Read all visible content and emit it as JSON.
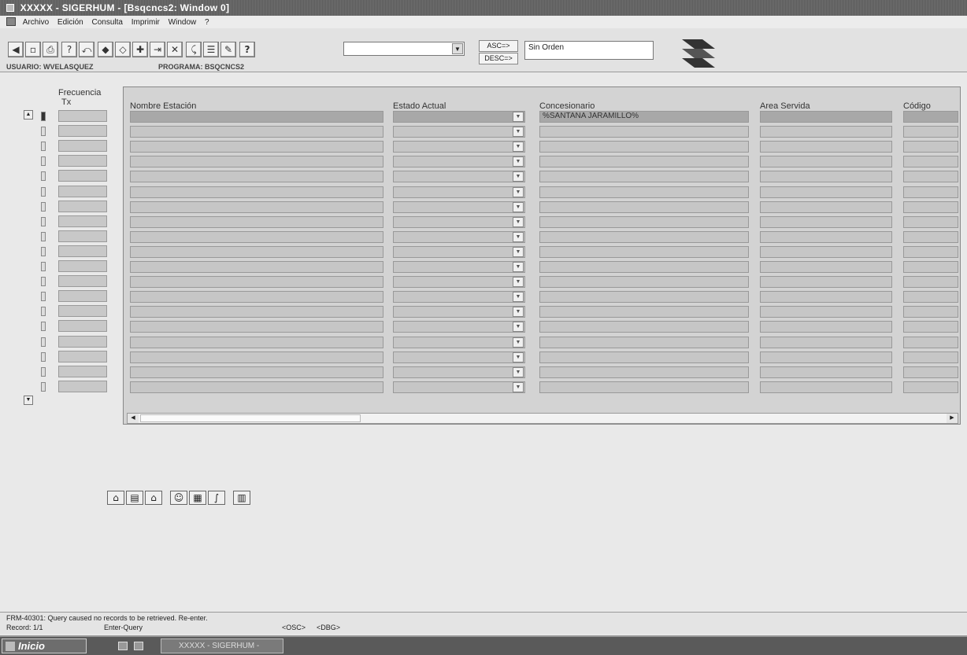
{
  "window": {
    "title": "XXXXX - SIGERHUM - [Bsqcncs2: Window 0]"
  },
  "menu": {
    "items": [
      "Archivo",
      "Edición",
      "Consulta",
      "Imprimir",
      "Window",
      "?"
    ]
  },
  "toolbar": {
    "icons": [
      "exit-icon",
      "save-icon",
      "print-icon",
      "query-icon",
      "clear-icon",
      "prev-record-icon",
      "next-record-icon",
      "insert-record-icon",
      "delete-record-icon",
      "clear-record-icon",
      "search-icon",
      "edit-icon",
      "list-icon",
      "help-icon"
    ],
    "combo_value": "",
    "asc_label": "ASC=>",
    "desc_label": "DESC=>",
    "order_value": "Sin Orden"
  },
  "session": {
    "user": "USUARIO: WVELASQUEZ",
    "program": "PROGRAMA: BSQCNCS2"
  },
  "grid": {
    "freq_header_line1": "Frecuencia",
    "freq_header_line2": "Tx",
    "columns": [
      "Nombre Estación",
      "Estado Actual",
      "Concesionario",
      "Area Servida",
      "Código"
    ],
    "first_row_concesionario": "%SANTANA JARAMILLO%",
    "row_count": 19
  },
  "status": {
    "message": "FRM-40301: Query caused no records to be retrieved. Re-enter.",
    "record": "Record: 1/1",
    "mode": "Enter-Query",
    "osc": "<OSC>",
    "dbg": "<DBG>"
  },
  "taskbar": {
    "start": "Inicio",
    "task": "XXXXX - SIGERHUM -"
  }
}
